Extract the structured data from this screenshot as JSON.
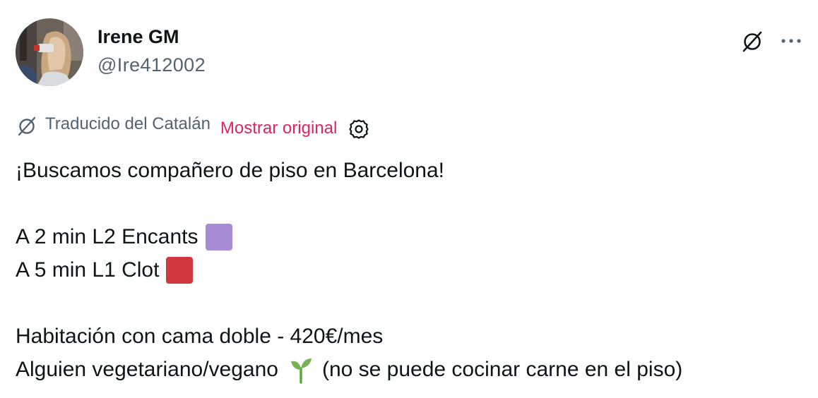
{
  "author": {
    "display_name": "Irene GM",
    "handle": "@Ire412002",
    "avatar_icon": "profile-photo"
  },
  "actions": {
    "translate_icon": "translate-icon",
    "more_icon": "more-options-icon"
  },
  "translation": {
    "label": "Traducido del Catalán",
    "show_original": "Mostrar original",
    "settings_icon": "gear-icon",
    "link_color": "#e0245e"
  },
  "tweet": {
    "line1": "¡Buscamos compañero de piso en Barcelona!",
    "line2": "A 2 min L2 Encants",
    "line2_square_color": "#a78bd4",
    "line3": "A 5 min L1 Clot",
    "line3_square_color": "#d0373f",
    "line4": "Habitación con cama doble - 420€/mes",
    "line5_a": "Alguien vegetariano/vegano",
    "line5_emoji": "seedling-emoji",
    "line5_b": "(no se puede cocinar carne en el piso)"
  }
}
